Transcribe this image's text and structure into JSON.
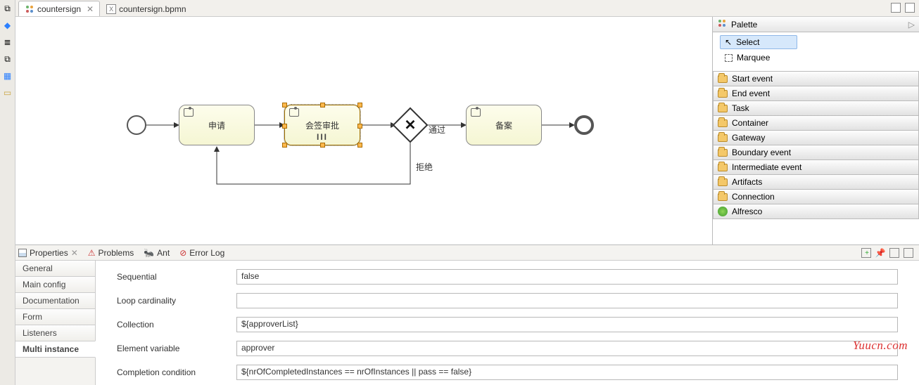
{
  "tabs": {
    "active": "countersign",
    "second": "countersign.bpmn"
  },
  "diagram": {
    "tasks": {
      "apply": "申请",
      "approve": "会签审批",
      "record": "备案"
    },
    "labels": {
      "pass": "通过",
      "reject": "拒绝"
    },
    "mi_marker": "III"
  },
  "palette": {
    "title": "Palette",
    "tools": {
      "select": "Select",
      "marquee": "Marquee"
    },
    "cats": [
      "Start event",
      "End event",
      "Task",
      "Container",
      "Gateway",
      "Boundary event",
      "Intermediate event",
      "Artifacts",
      "Connection",
      "Alfresco"
    ]
  },
  "views": {
    "properties": "Properties",
    "problems": "Problems",
    "ant": "Ant",
    "errorlog": "Error Log"
  },
  "ptabs": [
    "General",
    "Main config",
    "Documentation",
    "Form",
    "Listeners",
    "Multi instance"
  ],
  "form": {
    "sequential_lbl": "Sequential",
    "sequential_val": "false",
    "loop_lbl": "Loop cardinality",
    "loop_val": "",
    "collection_lbl": "Collection",
    "collection_val": "${approverList}",
    "elvar_lbl": "Element variable",
    "elvar_val": "approver",
    "comp_lbl": "Completion condition",
    "comp_val": "${nrOfCompletedInstances == nrOfInstances || pass == false}"
  },
  "watermark": "Yuucn.com"
}
